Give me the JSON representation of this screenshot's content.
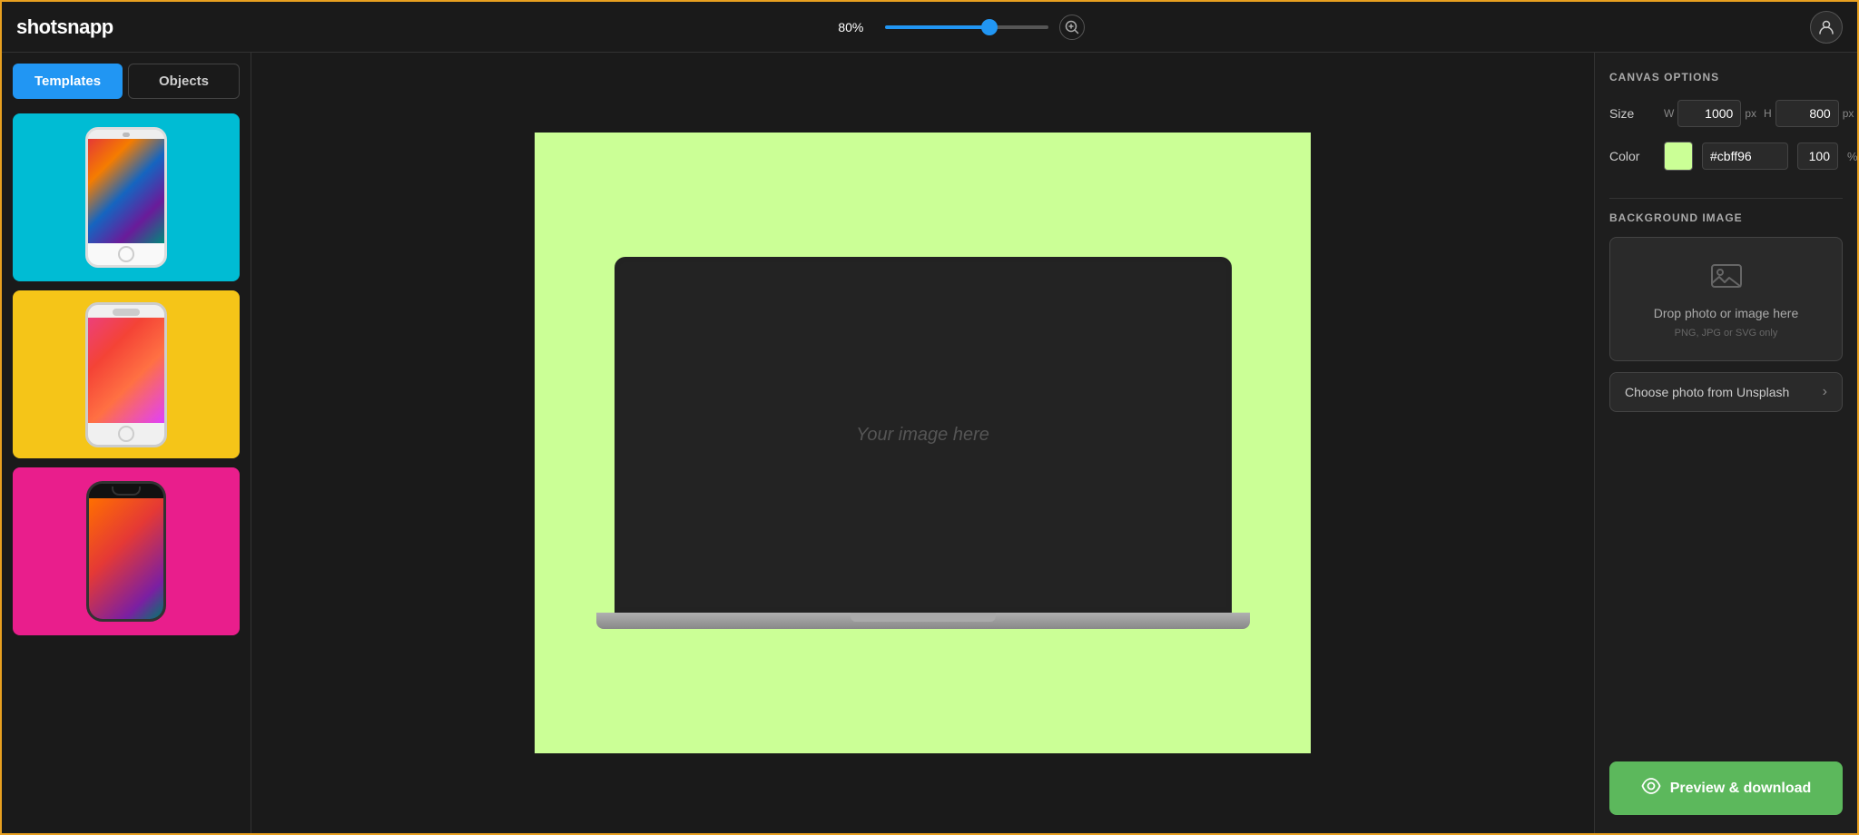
{
  "app": {
    "logo": "shotsnapp",
    "zoom": {
      "level": "80%",
      "slider_value": 65
    }
  },
  "sidebar": {
    "tabs": [
      {
        "id": "templates",
        "label": "Templates",
        "active": true
      },
      {
        "id": "objects",
        "label": "Objects",
        "active": false
      }
    ],
    "templates": [
      {
        "id": "t1",
        "bg": "#00bcd4",
        "phone_style": "notchless"
      },
      {
        "id": "t2",
        "bg": "#f5c518",
        "phone_style": "classic"
      },
      {
        "id": "t3",
        "bg": "#e91e8c",
        "phone_style": "notch"
      }
    ]
  },
  "canvas": {
    "bg_color": "#cbff96",
    "image_placeholder": "Your image here"
  },
  "right_panel": {
    "title": "CANVAS OPTIONS",
    "size_label": "Size",
    "width_label": "W",
    "width_value": "1000",
    "width_unit": "px",
    "height_label": "H",
    "height_value": "800",
    "height_unit": "px",
    "color_label": "Color",
    "color_hex": "#cbff96",
    "opacity_value": "100",
    "opacity_unit": "%",
    "bg_image_title": "BACKGROUND IMAGE",
    "drop_text": "Drop photo or image here",
    "drop_subtext": "PNG, JPG or SVG only",
    "unsplash_label": "Choose photo from Unsplash",
    "preview_label": "Preview & download"
  }
}
